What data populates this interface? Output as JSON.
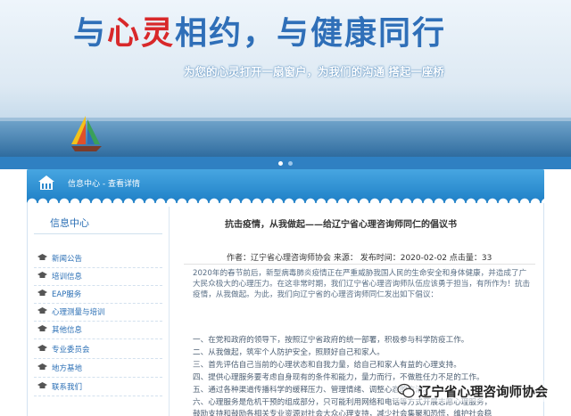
{
  "banner": {
    "slogan_part1": "与",
    "slogan_red": "心灵",
    "slogan_part2": "相约，与健康同行",
    "subslogan": "为您的心灵打开一扇窗户，为我们的沟通 搭起一座桥"
  },
  "breadcrumb": {
    "label": "信息中心 - 查看详情"
  },
  "sidebar": {
    "title": "信息中心",
    "items": [
      {
        "label": "新闻公告"
      },
      {
        "label": "培训信息"
      },
      {
        "label": "EAP服务"
      },
      {
        "label": "心理测量与培训"
      },
      {
        "label": "其他信息"
      },
      {
        "label": "专业委员会"
      },
      {
        "label": "地方基地"
      },
      {
        "label": "联系我们"
      }
    ]
  },
  "article": {
    "title": "抗击疫情，从我做起——给辽宁省心理咨询师同仁的倡议书",
    "meta_author": "作者：辽宁省心理咨询师协会 来源：  发布时间：2020-02-02 点击量：33",
    "paragraphs": [
      "2020年的春节前后，新型病毒肺炎疫情正在严重威胁我国人民的生命安全和身体健康，并造成了广大民众极大的心理压力。在这非常时期，我们辽宁省心理咨询师队伍应该勇于担当，有所作为！抗击疫情，从我做起。为此，我们向辽宁省的心理咨询师同仁发出如下倡议："
    ],
    "list": [
      "一、在党和政府的领导下，按照辽宁省政府的统一部署，积极参与科学防疫工作。",
      "二、从我做起，筑牢个人防护安全，照顾好自己和家人。",
      "三、首先评估自己当前的心理状态和自我力量，给自己和家人有益的心理支持。",
      "四、提供心理服务要考虑自身现有的条件和能力，量力而行，不做胜任力不足的工作。",
      "五、通过各种渠道传播科学的缓释压力、管理情绪、调整心态的方法。",
      "六、心理服务是危机干预的组成部分，只可能利用网络和电话等方式开展志愿心理服务，",
      "鼓励支持和鼓励各相关专业资源对社会大众心理支持，减少社会集聚和恐慌，维护社会稳"
    ]
  },
  "watermark": {
    "text": "辽宁省心理咨询师协会"
  },
  "colors": {
    "brand_blue": "#2f6fb8",
    "accent_red": "#d8282a",
    "bar_blue": "#2f80c2",
    "link_blue": "#2b6fb5"
  }
}
